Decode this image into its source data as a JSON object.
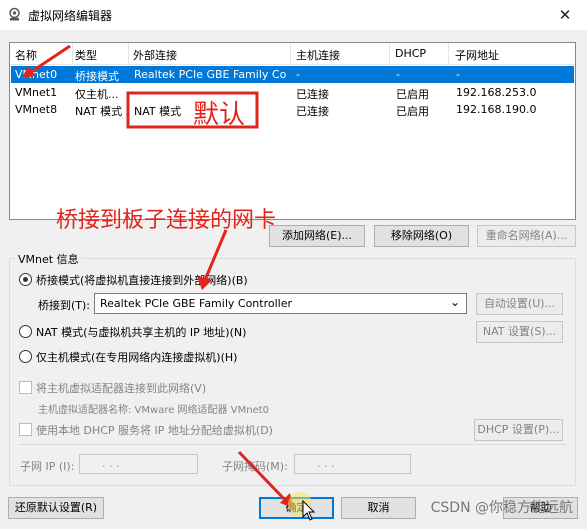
{
  "window": {
    "title": "虚拟网络编辑器",
    "close_glyph": "✕"
  },
  "table": {
    "columns": [
      "名称",
      "类型",
      "外部连接",
      "主机连接",
      "DHCP",
      "子网地址"
    ],
    "rows": [
      {
        "name": "VMnet0",
        "type": "桥接模式",
        "external": "Realtek PCIe GBE Family Co...",
        "host": "-",
        "dhcp": "-",
        "subnet": "-",
        "selected": true
      },
      {
        "name": "VMnet1",
        "type": "仅主机...",
        "external": "",
        "host": "已连接",
        "dhcp": "已启用",
        "subnet": "192.168.253.0",
        "selected": false
      },
      {
        "name": "VMnet8",
        "type": "NAT 模式",
        "external": "NAT 模式",
        "host": "已连接",
        "dhcp": "已启用",
        "subnet": "192.168.190.0",
        "selected": false
      }
    ]
  },
  "table_buttons": {
    "add": "添加网络(E)...",
    "remove": "移除网络(O)",
    "rename": "重命名网络(A)..."
  },
  "vmnet_info": {
    "group_title": "VMnet 信息",
    "bridged_label": "桥接模式(将虚拟机直接连接到外部网络)(B)",
    "bridged_to_label": "桥接到(T):",
    "bridged_to_value": "Realtek PCIe GBE Family Controller",
    "auto_settings": "自动设置(U)...",
    "nat_label": "NAT 模式(与虚拟机共享主机的 IP 地址)(N)",
    "nat_settings": "NAT 设置(S)...",
    "hostonly_label": "仅主机模式(在专用网络内连接虚拟机)(H)",
    "connect_adapter_label": "将主机虚拟适配器连接到此网络(V)",
    "adapter_name_label": "主机虚拟适配器名称: VMware 网络适配器 VMnet0",
    "use_dhcp_label": "使用本地 DHCP 服务将 IP 地址分配给虚拟机(D)",
    "dhcp_settings": "DHCP 设置(P)...",
    "subnet_ip_label": "子网 IP (I):",
    "subnet_mask_label": "子网掩码(M):",
    "ip_placeholder": ".       .       ."
  },
  "footer": {
    "restore_defaults": "还原默认设置(R)",
    "ok": "确定",
    "cancel": "取消",
    "help": "帮助"
  },
  "annotations": {
    "default_note": "默认",
    "bridge_note": "桥接到板子连接的网卡",
    "color": "#e1251b"
  },
  "watermark": "CSDN @你稳方能远航"
}
